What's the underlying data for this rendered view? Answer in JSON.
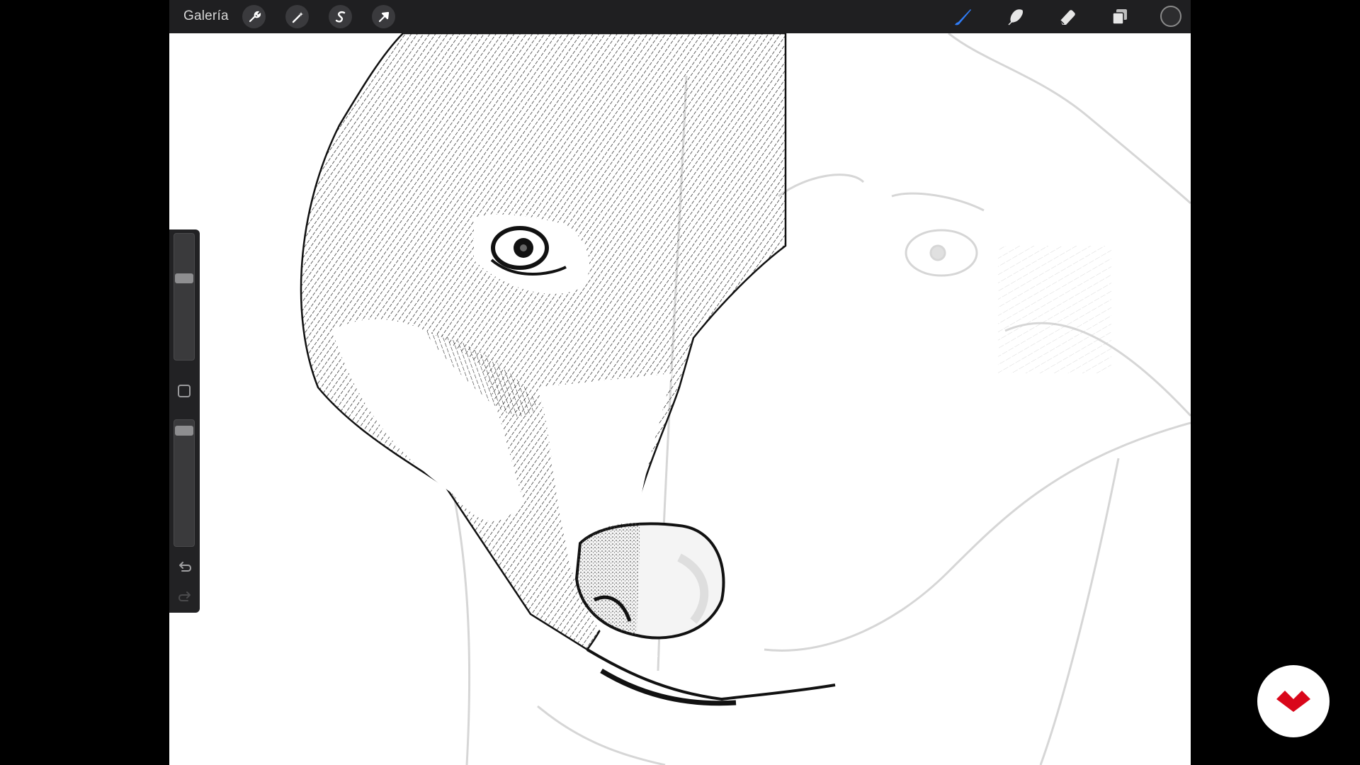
{
  "topbar": {
    "gallery_label": "Galería",
    "left_tools": [
      {
        "name": "actions",
        "icon": "wrench-icon"
      },
      {
        "name": "adjustments",
        "icon": "magic-wand-icon"
      },
      {
        "name": "selection",
        "icon": "selection-s-icon"
      },
      {
        "name": "transform",
        "icon": "arrow-cursor-icon"
      }
    ],
    "right_tools": [
      {
        "name": "brush",
        "icon": "brush-icon",
        "active": true,
        "color": "#2f7cf6"
      },
      {
        "name": "smudge",
        "icon": "smudge-finger-icon"
      },
      {
        "name": "eraser",
        "icon": "eraser-icon"
      },
      {
        "name": "layers",
        "icon": "layers-icon"
      }
    ],
    "current_color": "#2d2d2f"
  },
  "sidebar": {
    "brush_size_level": 0.34,
    "opacity_level": 0.05
  },
  "logo": {
    "color": "#d9061a"
  }
}
